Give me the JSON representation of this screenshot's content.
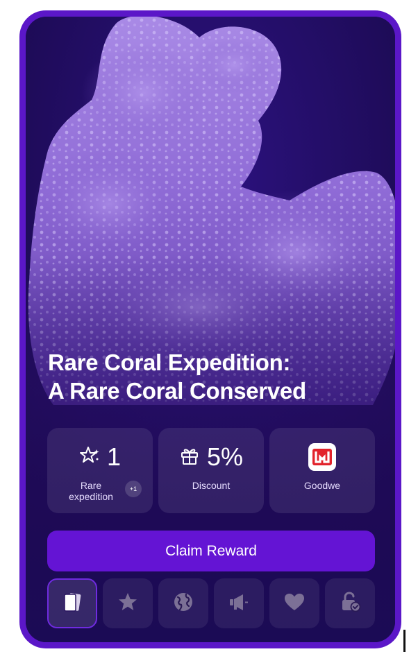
{
  "card": {
    "title_line1": "Rare Coral Expedition:",
    "title_line2": "A Rare Coral Conserved"
  },
  "stats": [
    {
      "icon": "sparkle-star-icon",
      "value": "1",
      "label_line1": "Rare",
      "label_line2": "expedition",
      "badge": "+1"
    },
    {
      "icon": "gift-icon",
      "value": "5%",
      "label": "Discount"
    },
    {
      "icon": "goodwe-logo",
      "label": "Goodwe",
      "logo_letter": "W"
    }
  ],
  "claim_button": {
    "label": "Claim Reward"
  },
  "tabs": [
    {
      "icon": "cards-icon",
      "active": true
    },
    {
      "icon": "star-icon"
    },
    {
      "icon": "globe-icon"
    },
    {
      "icon": "megaphone-icon"
    },
    {
      "icon": "heart-icon"
    },
    {
      "icon": "unlock-check-icon"
    }
  ],
  "colors": {
    "card_border": "#5b17c8",
    "background": "#1a0a52",
    "button": "#6414d4",
    "logo_red": "#e2232b"
  }
}
